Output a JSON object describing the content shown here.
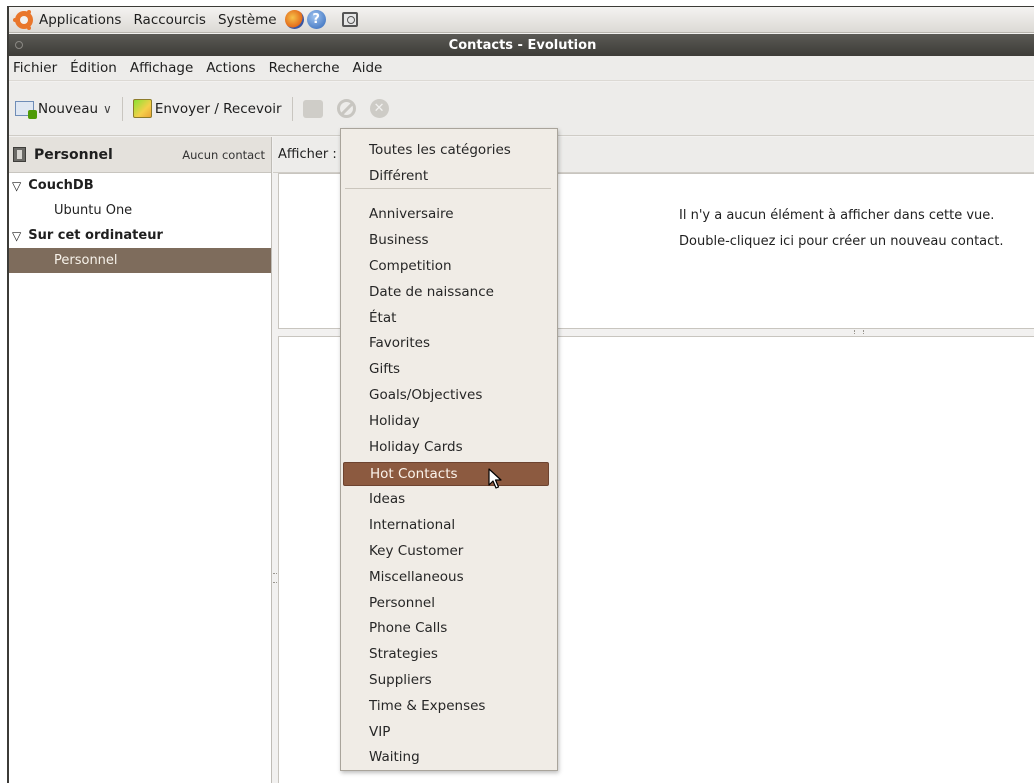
{
  "top_panel": {
    "applications": "Applications",
    "places": "Raccourcis",
    "system": "Système",
    "help_glyph": "?"
  },
  "window": {
    "title": "Contacts - Evolution"
  },
  "menubar": [
    "Fichier",
    "Édition",
    "Affichage",
    "Actions",
    "Recherche",
    "Aide"
  ],
  "toolbar": {
    "new_label": "Nouveau",
    "send_receive_label": "Envoyer / Recevoir",
    "cancel_glyph": "✕"
  },
  "sidebar": {
    "title": "Personnel",
    "count": "Aucun contact",
    "groups": [
      {
        "label": "CouchDB",
        "items": [
          "Ubuntu One"
        ]
      },
      {
        "label": "Sur cet ordinateur",
        "items": [
          "Personnel"
        ]
      }
    ],
    "selected_item": "Personnel"
  },
  "filter": {
    "label": "Afficher :"
  },
  "content": {
    "empty_message": "Il n'y a aucun élément à afficher dans cette vue.",
    "hint": "Double-cliquez ici pour créer un nouveau contact."
  },
  "category_menu": {
    "top_items": [
      "Toutes les catégories",
      "Différent"
    ],
    "items": [
      "Anniversaire",
      "Business",
      "Competition",
      "Date de naissance",
      "État",
      "Favorites",
      "Gifts",
      "Goals/Objectives",
      "Holiday",
      "Holiday Cards",
      "Hot Contacts",
      "Ideas",
      "International",
      "Key Customer",
      "Miscellaneous",
      "Personnel",
      "Phone Calls",
      "Strategies",
      "Suppliers",
      "Time & Expenses",
      "VIP",
      "Waiting"
    ],
    "highlighted": "Hot Contacts"
  }
}
